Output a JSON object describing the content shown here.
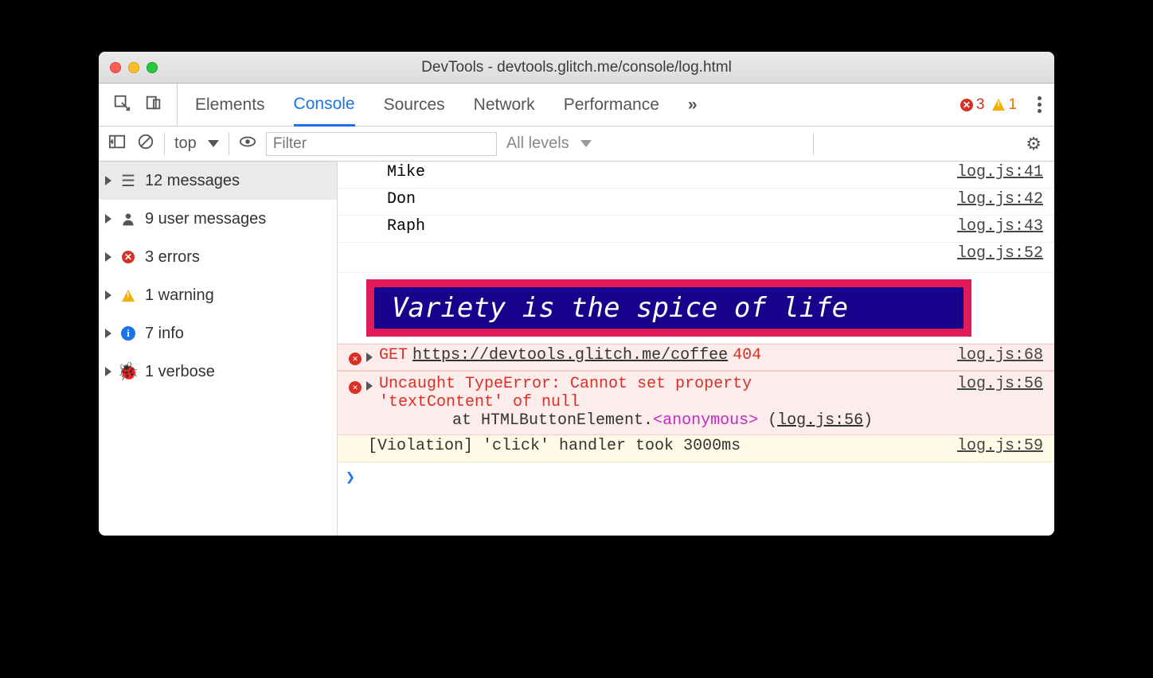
{
  "window": {
    "title": "DevTools - devtools.glitch.me/console/log.html"
  },
  "tabs": {
    "elements": "Elements",
    "console": "Console",
    "sources": "Sources",
    "network": "Network",
    "performance": "Performance",
    "more": "»"
  },
  "status": {
    "errors": "3",
    "warnings": "1"
  },
  "toolbar": {
    "context": "top",
    "filter_placeholder": "Filter",
    "levels": "All levels"
  },
  "sidebar": {
    "messages": "12 messages",
    "userMessages": "9 user messages",
    "errors": "3 errors",
    "warning": "1 warning",
    "info": "7 info",
    "verbose": "1 verbose"
  },
  "log": {
    "l1": {
      "text": "Mike",
      "src": "log.js:41"
    },
    "l2": {
      "text": "Don",
      "src": "log.js:42"
    },
    "l3": {
      "text": "Raph",
      "src": "log.js:43"
    },
    "l4": {
      "src": "log.js:52"
    },
    "banner": "Variety is the spice of life",
    "err1": {
      "method": "GET",
      "url": "https://devtools.glitch.me/coffee",
      "status": "404",
      "src": "log.js:68"
    },
    "err2": {
      "line1": "Uncaught TypeError: Cannot set property",
      "line2": "'textContent' of null",
      "stack_prefix": "at HTMLButtonElement.",
      "stack_anon": "<anonymous>",
      "stack_open": " (",
      "stack_link": "log.js:56",
      "stack_close": ")",
      "src": "log.js:56"
    },
    "warn": {
      "text": "[Violation] 'click' handler took 3000ms",
      "src": "log.js:59"
    }
  }
}
